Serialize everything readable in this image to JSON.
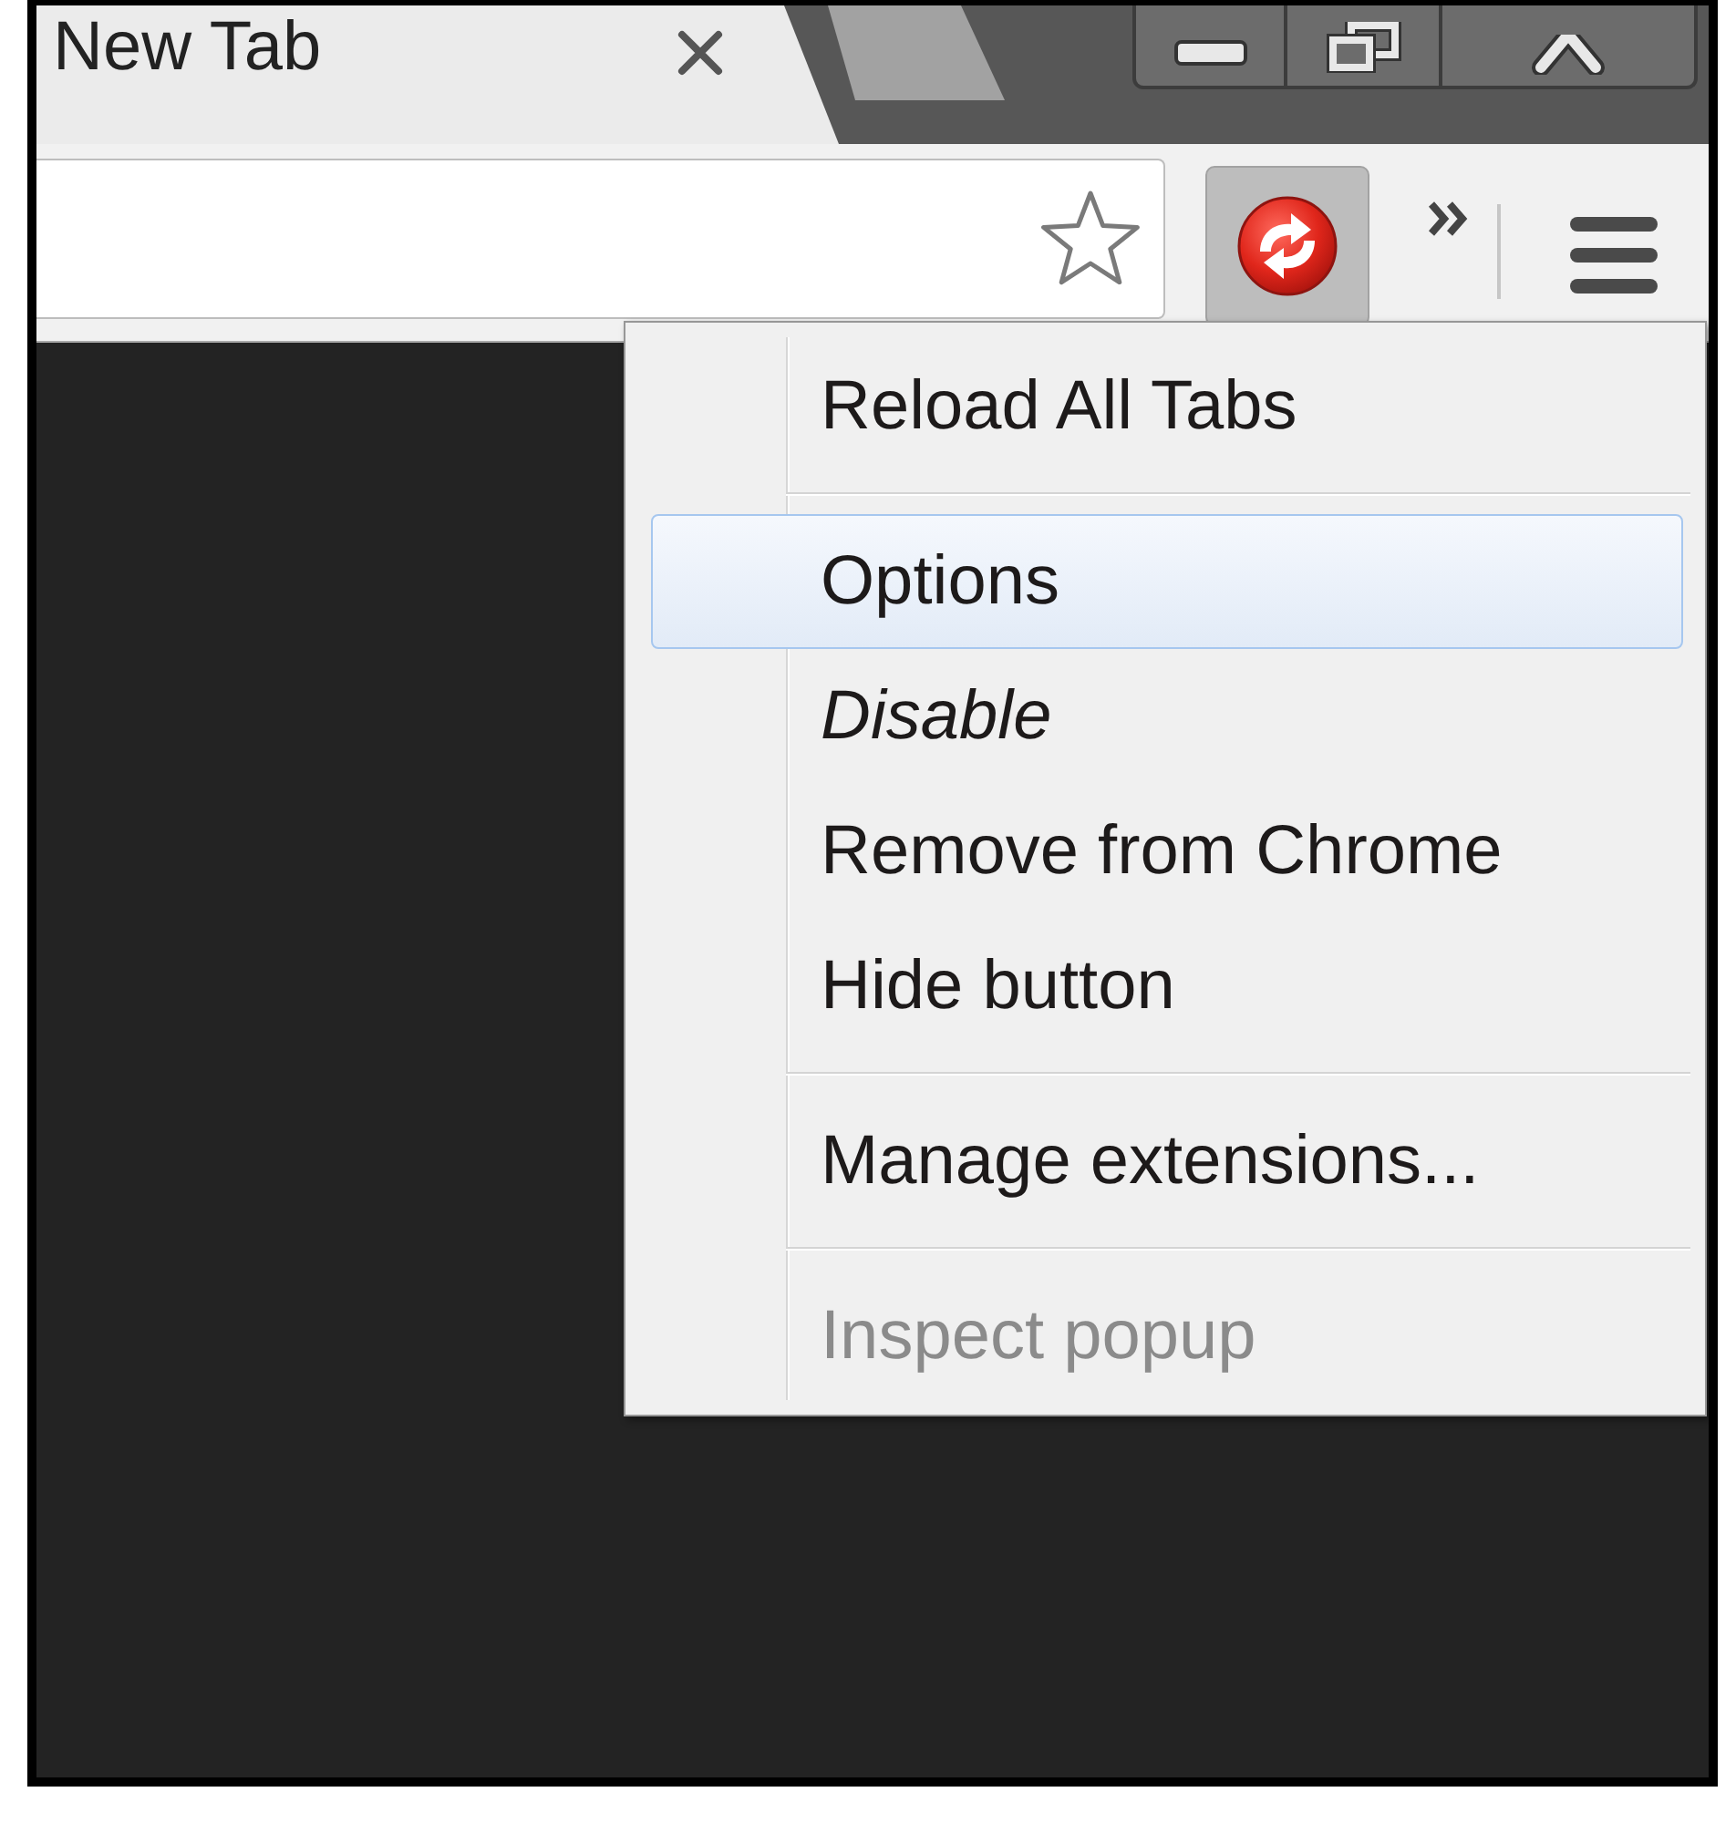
{
  "tabs": [
    {
      "title": "New Tab",
      "selected": true
    }
  ],
  "extension_button": {
    "pressed": true
  },
  "extension_menu": {
    "groups": [
      {
        "items": [
          {
            "label": "Reload All Tabs",
            "selected": false,
            "disabled": false,
            "italic": false
          }
        ]
      },
      {
        "items": [
          {
            "label": "Options",
            "selected": true,
            "disabled": false,
            "italic": false
          },
          {
            "label": "Disable",
            "selected": false,
            "disabled": false,
            "italic": true
          },
          {
            "label": "Remove from Chrome",
            "selected": false,
            "disabled": false,
            "italic": false
          },
          {
            "label": "Hide button",
            "selected": false,
            "disabled": false,
            "italic": false
          }
        ]
      },
      {
        "items": [
          {
            "label": "Manage extensions...",
            "selected": false,
            "disabled": false,
            "italic": false
          }
        ]
      },
      {
        "items": [
          {
            "label": "Inspect popup",
            "selected": false,
            "disabled": true,
            "italic": false
          }
        ]
      }
    ]
  }
}
